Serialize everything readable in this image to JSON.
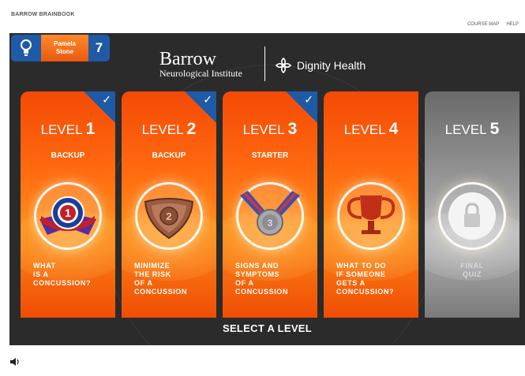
{
  "app_title": "BARROW BRAINBOOK",
  "nav": {
    "course_map": "COURSE MAP",
    "help": "HELP"
  },
  "user": {
    "first_name": "Pamela",
    "last_name": "Stone",
    "count": "7"
  },
  "logos": {
    "barrow_name": "Barrow",
    "barrow_sub": "Neurological Institute",
    "dignity": "Dignity Health"
  },
  "levels": [
    {
      "prefix": "LEVEL",
      "number": "1",
      "status": "BACKUP",
      "topic": [
        "WHAT",
        "IS A",
        "CONCUSSION?"
      ],
      "completed": true,
      "locked": false,
      "medal": "blue-ribbon-medal-icon"
    },
    {
      "prefix": "LEVEL",
      "number": "2",
      "status": "BACKUP",
      "topic": [
        "MINIMIZE",
        "THE RISK",
        "OF A",
        "CONCUSSION"
      ],
      "completed": true,
      "locked": false,
      "medal": "bronze-shield-medal-icon"
    },
    {
      "prefix": "LEVEL",
      "number": "3",
      "status": "STARTER",
      "topic": [
        "SIGNS AND",
        "SYMPTOMS",
        "OF A",
        "CONCUSSION"
      ],
      "completed": true,
      "locked": false,
      "medal": "silver-medal-icon"
    },
    {
      "prefix": "LEVEL",
      "number": "4",
      "status": "",
      "topic": [
        "WHAT TO DO",
        "IF SOMEONE",
        "GETS A",
        "CONCUSSION?"
      ],
      "completed": false,
      "locked": false,
      "medal": "trophy-icon"
    },
    {
      "prefix": "LEVEL",
      "number": "5",
      "status": "",
      "topic": [
        "FINAL",
        "QUIZ"
      ],
      "completed": false,
      "locked": true,
      "medal": "lock-icon"
    }
  ],
  "select_label": "SELECT A LEVEL",
  "colors": {
    "accent_blue": "#1f5aa6",
    "orange": "#ff6a10",
    "stage": "#2b2b2c"
  }
}
